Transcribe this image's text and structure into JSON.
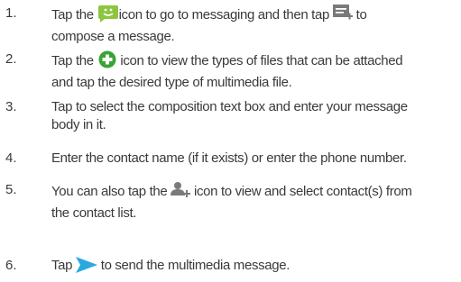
{
  "steps": [
    {
      "number": "1.",
      "parts": [
        "Tap the ",
        "icon to go to messaging and then tap ",
        " to",
        "compose a message."
      ],
      "icons": [
        "messaging-app-icon",
        "compose-message-icon"
      ]
    },
    {
      "number": "2.",
      "parts": [
        "Tap the ",
        " icon to view the types of files that can be attached",
        "and tap the desired type of multimedia file."
      ],
      "icons": [
        "attach-plus-icon"
      ]
    },
    {
      "number": "3.",
      "parts": [
        "Tap to select the composition text box and enter your message",
        "body in it."
      ]
    },
    {
      "number": "4.",
      "parts": [
        "Enter the contact name (if it exists) or enter the phone number."
      ]
    },
    {
      "number": "5.",
      "parts": [
        "You can also tap the ",
        " icon to view and select contact(s) from",
        "the contact list."
      ],
      "icons": [
        "add-contact-icon"
      ]
    },
    {
      "number": "6.",
      "parts": [
        "Tap ",
        " to send the multimedia message."
      ],
      "icons": [
        "send-arrow-icon"
      ]
    }
  ],
  "colors": {
    "text": "#3a3a3a",
    "messaging_icon_green": "#8cc63f",
    "attach_icon_green": "#3aa335",
    "send_icon_blue": "#2aa8e0",
    "compose_icon_gray": "#7a7a7a"
  }
}
